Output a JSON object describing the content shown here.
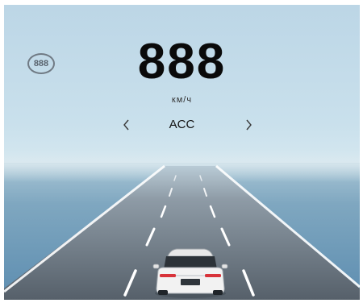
{
  "cluster": {
    "speed_limit_badge": "888",
    "speed_value": "888",
    "speed_unit": "км/ч",
    "mode_label": "ACC",
    "prev_icon": "chevron-left-icon",
    "next_icon": "chevron-right-icon"
  },
  "colors": {
    "sky_top": "#bcd6e6",
    "sea": "#5d8db0",
    "road": "#5c6670",
    "lane_marking": "#ffffff",
    "car": "#f4f4f4"
  }
}
